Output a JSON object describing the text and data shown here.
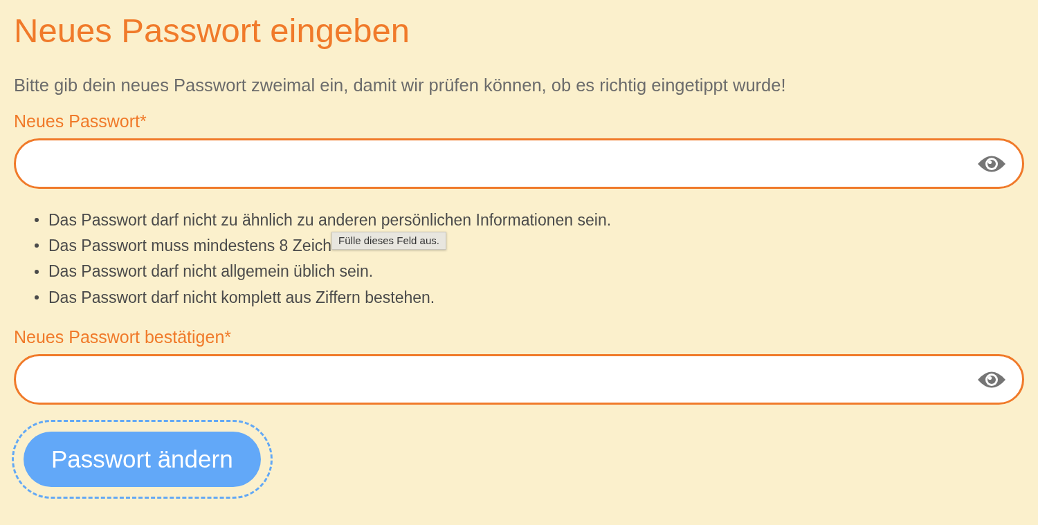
{
  "title": "Neues Passwort eingeben",
  "intro": "Bitte gib dein neues Passwort zweimal ein, damit wir prüfen können, ob es richtig eingetippt wurde!",
  "fields": [
    {
      "label": "Neues Passwort*",
      "rules": [
        {
          "text": "Das Passwort darf nicht zu ähnlich zu anderen persönlichen Informationen sein."
        },
        {
          "text": "Das Passwort muss mindestens 8 Zeich",
          "tooltip": "Fülle dieses Feld aus."
        },
        {
          "text": "Das Passwort darf nicht allgemein üblich sein."
        },
        {
          "text": "Das Passwort darf nicht komplett aus Ziffern bestehen."
        }
      ]
    },
    {
      "label": "Neues Passwort bestätigen*"
    }
  ],
  "submit": {
    "label": "Passwort ändern",
    "focused": true
  }
}
